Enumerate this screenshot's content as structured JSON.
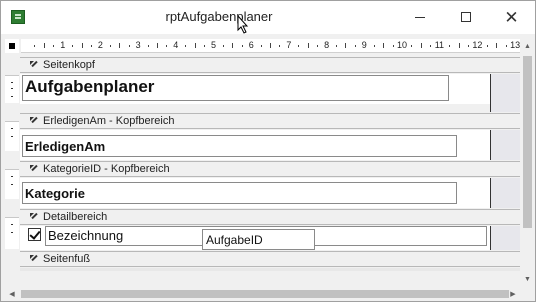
{
  "window": {
    "title": "rptAufgabenplaner"
  },
  "ruler": {
    "numbers": [
      "1",
      "2",
      "3",
      "4",
      "5",
      "6",
      "7",
      "8",
      "9",
      "10",
      "11",
      "12",
      "13"
    ]
  },
  "sections": {
    "page_header": {
      "label": "Seitenkopf",
      "title_text": "Aufgabenplaner"
    },
    "erledigen_header": {
      "label": "ErledigenAm - Kopfbereich",
      "field_text": "ErledigenAm"
    },
    "kategorie_header": {
      "label": "KategorieID - Kopfbereich",
      "field_text": "Kategorie"
    },
    "detail": {
      "label": "Detailbereich",
      "checkbox_checked": true,
      "field_text": "Bezeichnung",
      "id_field_text": "AufgabeID"
    },
    "page_footer": {
      "label": "Seitenfuß"
    }
  },
  "icons": {
    "app": "access-report-icon",
    "section_selector": "section-arrow-icon"
  }
}
